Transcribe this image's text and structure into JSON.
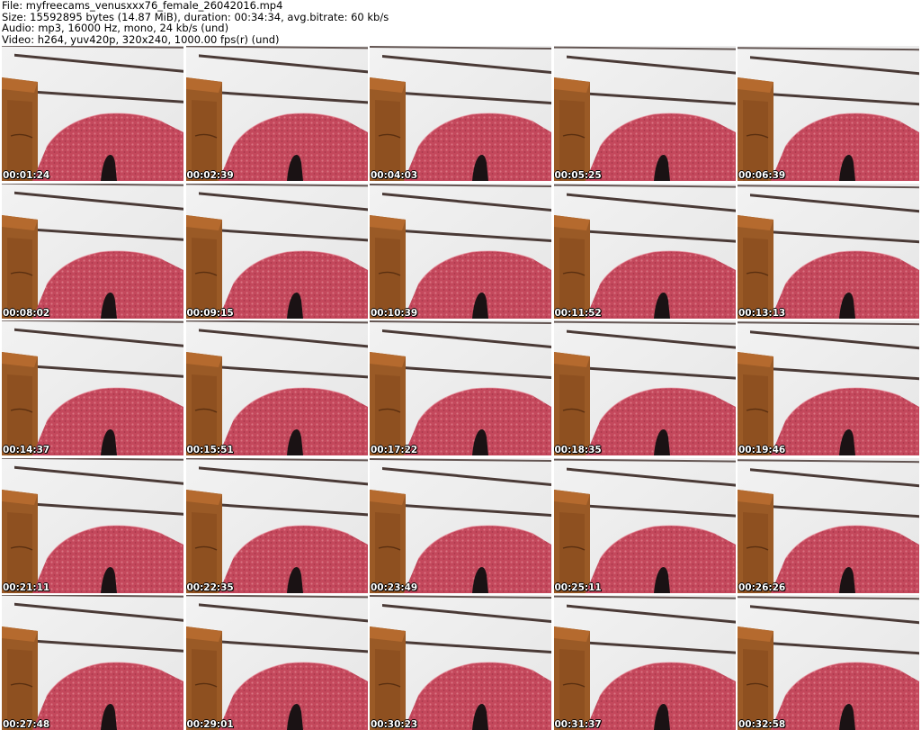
{
  "info": {
    "line1": "File: myfreecams_venusxxx76_female_26042016.mp4",
    "line2": "Size: 15592895 bytes (14.87 MiB), duration: 00:34:34, avg.bitrate: 60 kb/s",
    "line3": "Audio: mp3, 16000 Hz, mono, 24 kb/s (und)",
    "line4": "Video: h264, yuv420p, 320x240, 1000.00 fps(r) (und)"
  },
  "thumbnails": [
    {
      "timestamp": "00:01:24"
    },
    {
      "timestamp": "00:02:39"
    },
    {
      "timestamp": "00:04:03"
    },
    {
      "timestamp": "00:05:25"
    },
    {
      "timestamp": "00:06:39"
    },
    {
      "timestamp": "00:08:02"
    },
    {
      "timestamp": "00:09:15"
    },
    {
      "timestamp": "00:10:39"
    },
    {
      "timestamp": "00:11:52"
    },
    {
      "timestamp": "00:13:13"
    },
    {
      "timestamp": "00:14:37"
    },
    {
      "timestamp": "00:15:51"
    },
    {
      "timestamp": "00:17:22"
    },
    {
      "timestamp": "00:18:35"
    },
    {
      "timestamp": "00:19:46"
    },
    {
      "timestamp": "00:21:11"
    },
    {
      "timestamp": "00:22:35"
    },
    {
      "timestamp": "00:23:49"
    },
    {
      "timestamp": "00:25:11"
    },
    {
      "timestamp": "00:26:26"
    },
    {
      "timestamp": "00:27:48"
    },
    {
      "timestamp": "00:29:01"
    },
    {
      "timestamp": "00:30:23"
    },
    {
      "timestamp": "00:31:37"
    },
    {
      "timestamp": "00:32:58"
    }
  ],
  "colors": {
    "wall": "#e6e6e6",
    "stripe": "#4a3a36",
    "wood": "#9a5a26",
    "blanket": "#c4485c",
    "shadow": "#1a1214"
  }
}
